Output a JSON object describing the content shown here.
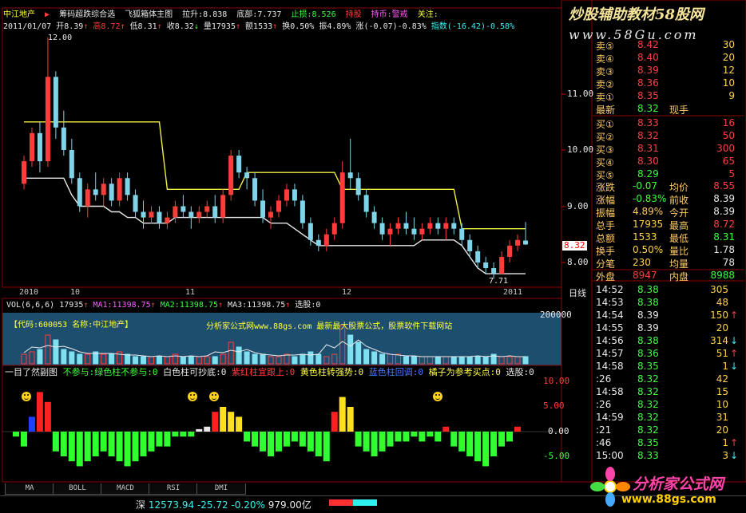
{
  "header": {
    "stock_name": "中江地产",
    "arrow": "▶",
    "indicator_name": "筹码超跌综合选",
    "main_indicator": "飞狐箱体主图",
    "pull_label": "拉升:8.838",
    "bottom_label": "底部:7.737",
    "stop_label": "止损:8.526",
    "hold_label": "持股",
    "hold_coin_label": "持币:警戒",
    "watch_label": "关注:",
    "date": "2011/01/07",
    "open": "开8.39",
    "high": "高8.72",
    "low": "低8.31",
    "close": "收8.32",
    "volume": "量17935",
    "amount": "额1533",
    "turnover": "换0.50%",
    "amplitude": "振4.89%",
    "change": "涨(-0.07)-0.83%",
    "index_change": "指数(-16.42)-0.58%"
  },
  "watermark": {
    "title": "炒股辅助教材58股网",
    "url": "www.58Gu.com"
  },
  "price_axis": {
    "ticks": [
      "11.00",
      "10.00",
      "9.00",
      "8.00"
    ],
    "current": "8.32",
    "peak": "12.00",
    "trough": "7.71"
  },
  "time_axis": {
    "labels": [
      "2010",
      "10",
      "11",
      "12",
      "2011"
    ],
    "period": "日线"
  },
  "volume_panel": {
    "header": "VOL(6,6,6)",
    "vol": "17935",
    "ma1": "MA1:11398.75",
    "ma2": "MA2:11398.75",
    "ma3": "MA3:11398.75",
    "extra": "选股:0",
    "code_text": "【代码:600053 名称:中江地产】",
    "site_text": "分析家公式网www.88gs.com 最新最大股票公式，股票软件下载网站",
    "axis_top": "200000"
  },
  "sub_panel": {
    "title": "一目了然副图",
    "legend": [
      "不参与:绿色柱不参与:0",
      "白色柱可抄底:0",
      "紫红柱宜跟上:0",
      "黄色柱转强势:0",
      "蓝色柱回调:0",
      "橘子为参考买点:0",
      "选股:0"
    ],
    "axis": [
      "10.00",
      "5.00",
      "0.00",
      "-5.00"
    ]
  },
  "quotes": {
    "asks": [
      {
        "label": "卖⑤",
        "price": "8.42",
        "vol": "30"
      },
      {
        "label": "卖④",
        "price": "8.40",
        "vol": "20"
      },
      {
        "label": "卖③",
        "price": "8.39",
        "vol": "12"
      },
      {
        "label": "卖②",
        "price": "8.36",
        "vol": "10"
      },
      {
        "label": "卖①",
        "price": "8.35",
        "vol": "9"
      }
    ],
    "last_label": "最新",
    "last": "8.32",
    "last_type": "现手",
    "bids": [
      {
        "label": "买①",
        "price": "8.33",
        "vol": "16"
      },
      {
        "label": "买②",
        "price": "8.32",
        "vol": "50"
      },
      {
        "label": "买③",
        "price": "8.31",
        "vol": "300"
      },
      {
        "label": "买④",
        "price": "8.30",
        "vol": "65"
      },
      {
        "label": "买⑤",
        "price": "8.29",
        "vol": "5"
      }
    ],
    "stats": [
      {
        "l1": "涨跌",
        "v1": "-0.07",
        "l2": "均价",
        "v2": "8.55"
      },
      {
        "l1": "涨幅",
        "v1": "-0.83%",
        "l2": "前收",
        "v2": "8.39"
      },
      {
        "l1": "振幅",
        "v1": "4.89%",
        "l2": "今开",
        "v2": "8.39"
      },
      {
        "l1": "总手",
        "v1": "17935",
        "l2": "最高",
        "v2": "8.72"
      },
      {
        "l1": "总额",
        "v1": "1533",
        "l2": "最低",
        "v2": "8.31"
      },
      {
        "l1": "换手",
        "v1": "0.50%",
        "l2": "量比",
        "v2": "1.78"
      },
      {
        "l1": "分笔",
        "v1": "230",
        "l2": "均量",
        "v2": "78"
      }
    ],
    "outer_label": "外盘",
    "outer": "8947",
    "inner_label": "内盘",
    "inner": "8988"
  },
  "ticks": [
    {
      "t": "14:52",
      "p": "8.38",
      "v": "305",
      "d": ""
    },
    {
      "t": "14:53",
      "p": "8.38",
      "v": "48",
      "d": ""
    },
    {
      "t": "14:54",
      "p": "8.39",
      "v": "150",
      "d": "↑"
    },
    {
      "t": "14:55",
      "p": "8.39",
      "v": "20",
      "d": ""
    },
    {
      "t": "14:56",
      "p": "8.38",
      "v": "314",
      "d": "↓"
    },
    {
      "t": "14:57",
      "p": "8.36",
      "v": "51",
      "d": "↑"
    },
    {
      "t": "14:58",
      "p": "8.35",
      "v": "1",
      "d": "↓"
    },
    {
      "t": ":26",
      "p": "8.32",
      "v": "42",
      "d": ""
    },
    {
      "t": "14:58",
      "p": "8.32",
      "v": "15",
      "d": ""
    },
    {
      "t": ":26",
      "p": "8.32",
      "v": "10",
      "d": ""
    },
    {
      "t": "14:59",
      "p": "8.32",
      "v": "31",
      "d": ""
    },
    {
      "t": ":21",
      "p": "8.32",
      "v": "20",
      "d": ""
    },
    {
      "t": ":46",
      "p": "8.35",
      "v": "1",
      "d": "↑"
    },
    {
      "t": "15:00",
      "p": "8.33",
      "v": "3",
      "d": "↓"
    }
  ],
  "tabs": [
    "MA",
    "BOLL",
    "MACD",
    "RSI",
    "DMI"
  ],
  "status": {
    "market": "深",
    "index": "12573.94",
    "change": "-25.72",
    "pct": "-0.20%",
    "amount": "979.00亿"
  },
  "brand": {
    "name": "分析家公式网",
    "url": "www.88gs.com"
  },
  "colors": {
    "up": "#ff3c3c",
    "down": "#7fd4e8",
    "box": "#f0f040",
    "sub_green": "#30ff30",
    "sub_red": "#ff2020",
    "sub_yellow": "#ffe020",
    "sub_blue": "#2040ff"
  },
  "chart_data": {
    "type": "candlestick",
    "price_range": [
      7.6,
      12.2
    ],
    "candles": [
      [
        9.4,
        9.9,
        9.3,
        9.8
      ],
      [
        9.8,
        10.4,
        9.7,
        10.3
      ],
      [
        10.3,
        10.5,
        9.6,
        9.8
      ],
      [
        9.8,
        12.0,
        9.7,
        11.3
      ],
      [
        11.3,
        11.4,
        10.2,
        10.4
      ],
      [
        10.4,
        10.7,
        9.9,
        10.0
      ],
      [
        10.0,
        10.2,
        9.4,
        9.5
      ],
      [
        9.5,
        9.6,
        8.9,
        9.0
      ],
      [
        9.0,
        9.4,
        8.8,
        9.3
      ],
      [
        9.3,
        9.6,
        9.1,
        9.2
      ],
      [
        9.2,
        9.5,
        9.0,
        9.4
      ],
      [
        9.4,
        9.5,
        9.0,
        9.1
      ],
      [
        9.1,
        9.6,
        9.0,
        9.5
      ],
      [
        9.5,
        9.6,
        9.1,
        9.2
      ],
      [
        9.2,
        9.3,
        8.8,
        8.9
      ],
      [
        8.9,
        9.1,
        8.6,
        8.8
      ],
      [
        8.8,
        9.0,
        8.7,
        8.9
      ],
      [
        8.9,
        9.0,
        8.6,
        8.7
      ],
      [
        8.7,
        8.9,
        8.6,
        8.8
      ],
      [
        8.8,
        9.1,
        8.7,
        9.0
      ],
      [
        9.0,
        9.2,
        8.8,
        8.9
      ],
      [
        8.9,
        9.0,
        8.6,
        8.8
      ],
      [
        8.8,
        9.0,
        8.7,
        8.9
      ],
      [
        8.9,
        9.1,
        8.8,
        9.0
      ],
      [
        9.0,
        9.2,
        8.7,
        8.8
      ],
      [
        8.8,
        9.3,
        8.7,
        9.2
      ],
      [
        9.2,
        10.0,
        9.1,
        9.9
      ],
      [
        9.9,
        10.0,
        9.5,
        9.6
      ],
      [
        9.6,
        9.7,
        9.3,
        9.5
      ],
      [
        9.5,
        9.6,
        9.0,
        9.1
      ],
      [
        9.1,
        9.3,
        8.7,
        8.8
      ],
      [
        8.8,
        9.0,
        8.6,
        8.9
      ],
      [
        8.9,
        9.2,
        8.8,
        9.1
      ],
      [
        9.1,
        9.4,
        9.0,
        9.3
      ],
      [
        9.3,
        9.4,
        9.0,
        9.1
      ],
      [
        9.1,
        9.2,
        8.6,
        8.7
      ],
      [
        8.7,
        8.8,
        8.3,
        8.4
      ],
      [
        8.4,
        8.5,
        8.2,
        8.3
      ],
      [
        8.3,
        8.6,
        8.2,
        8.5
      ],
      [
        8.5,
        8.8,
        8.4,
        8.7
      ],
      [
        8.7,
        9.8,
        8.6,
        9.6
      ],
      [
        9.6,
        10.2,
        9.3,
        9.5
      ],
      [
        9.5,
        9.6,
        9.1,
        9.2
      ],
      [
        9.2,
        9.3,
        8.8,
        8.9
      ],
      [
        8.9,
        9.0,
        8.6,
        8.7
      ],
      [
        8.7,
        8.8,
        8.4,
        8.5
      ],
      [
        8.5,
        8.7,
        8.3,
        8.6
      ],
      [
        8.6,
        8.8,
        8.5,
        8.7
      ],
      [
        8.7,
        8.9,
        8.5,
        8.6
      ],
      [
        8.6,
        8.8,
        8.4,
        8.5
      ],
      [
        8.5,
        8.7,
        8.4,
        8.6
      ],
      [
        8.6,
        8.8,
        8.5,
        8.7
      ],
      [
        8.7,
        8.8,
        8.5,
        8.6
      ],
      [
        8.6,
        8.8,
        8.4,
        8.7
      ],
      [
        8.7,
        8.8,
        8.5,
        8.6
      ],
      [
        8.6,
        8.7,
        8.3,
        8.4
      ],
      [
        8.4,
        8.5,
        8.1,
        8.2
      ],
      [
        8.2,
        8.3,
        7.9,
        8.0
      ],
      [
        8.0,
        8.1,
        7.8,
        7.9
      ],
      [
        7.9,
        8.0,
        7.71,
        7.8
      ],
      [
        7.8,
        8.2,
        7.8,
        8.1
      ],
      [
        8.1,
        8.4,
        8.0,
        8.3
      ],
      [
        8.3,
        8.5,
        8.2,
        8.4
      ],
      [
        8.39,
        8.72,
        8.31,
        8.32
      ]
    ],
    "box_yellow": [
      10.5,
      10.5,
      10.5,
      10.5,
      10.5,
      10.5,
      10.5,
      10.5,
      10.5,
      10.5,
      10.5,
      10.5,
      10.5,
      10.5,
      10.5,
      10.5,
      10.5,
      10.5,
      9.3,
      9.3,
      9.3,
      9.3,
      9.3,
      9.3,
      9.3,
      9.3,
      9.3,
      9.3,
      9.6,
      9.6,
      9.6,
      9.6,
      9.6,
      9.6,
      9.6,
      9.6,
      9.6,
      9.6,
      9.6,
      9.6,
      9.3,
      9.3,
      9.3,
      9.3,
      9.3,
      9.3,
      9.3,
      9.3,
      9.3,
      9.3,
      9.3,
      9.3,
      9.3,
      9.3,
      9.3,
      8.6,
      8.6,
      8.6,
      8.6,
      8.6,
      8.6,
      8.6,
      8.6,
      8.6
    ],
    "box_white": [
      9.5,
      9.5,
      9.5,
      9.5,
      9.5,
      9.5,
      9.2,
      9.0,
      9.0,
      9.0,
      9.0,
      8.9,
      8.9,
      8.8,
      8.8,
      8.7,
      8.7,
      8.7,
      8.7,
      8.8,
      8.8,
      8.8,
      8.8,
      8.8,
      8.8,
      8.8,
      8.8,
      8.8,
      8.8,
      8.8,
      8.8,
      8.7,
      8.7,
      8.7,
      8.6,
      8.5,
      8.4,
      8.3,
      8.3,
      8.3,
      8.3,
      8.3,
      8.3,
      8.3,
      8.3,
      8.3,
      8.3,
      8.3,
      8.3,
      8.3,
      8.4,
      8.4,
      8.4,
      8.4,
      8.4,
      8.3,
      8.1,
      7.9,
      7.8,
      7.8,
      7.8,
      7.8,
      7.8,
      7.8
    ],
    "volume": [
      4,
      5,
      6,
      12,
      10,
      6,
      5,
      4,
      4,
      5,
      4,
      4,
      5,
      4,
      3,
      3,
      3,
      3,
      3,
      4,
      3,
      3,
      3,
      3,
      3,
      4,
      9,
      7,
      5,
      4,
      4,
      3,
      3,
      4,
      3,
      4,
      5,
      4,
      3,
      4,
      16,
      12,
      9,
      6,
      5,
      4,
      4,
      4,
      3,
      3,
      3,
      3,
      3,
      3,
      3,
      3,
      3,
      3,
      3,
      4,
      3,
      3,
      3,
      3
    ],
    "sub_bars": [
      -1,
      -3,
      3,
      8,
      6,
      -4,
      -5,
      -6,
      -7,
      -6,
      -5,
      -4,
      -5,
      -6,
      -7,
      -6,
      -5,
      -4,
      -3,
      -3,
      -1,
      -1,
      -1,
      0.5,
      1,
      4,
      5,
      4,
      3,
      -2,
      -3,
      -4,
      -5,
      -4,
      -3,
      -2,
      -3,
      -4,
      -5,
      -6,
      4,
      7,
      5,
      -3,
      -4,
      -5,
      -4,
      -3,
      -2,
      -2,
      -1,
      -2,
      -1,
      -2,
      1,
      -3,
      -4,
      -5,
      -6,
      -7,
      -5,
      -3,
      -2,
      1
    ],
    "sub_colors": [
      "g",
      "g",
      "b",
      "r",
      "r",
      "g",
      "g",
      "g",
      "g",
      "g",
      "g",
      "g",
      "g",
      "g",
      "g",
      "g",
      "g",
      "g",
      "g",
      "g",
      "g",
      "g",
      "g",
      "w",
      "w",
      "r",
      "y",
      "y",
      "y",
      "g",
      "g",
      "g",
      "g",
      "g",
      "g",
      "g",
      "g",
      "g",
      "g",
      "g",
      "r",
      "y",
      "y",
      "g",
      "g",
      "g",
      "g",
      "g",
      "g",
      "g",
      "g",
      "g",
      "g",
      "g",
      "r",
      "g",
      "g",
      "g",
      "g",
      "g",
      "g",
      "g",
      "g",
      "r"
    ]
  }
}
